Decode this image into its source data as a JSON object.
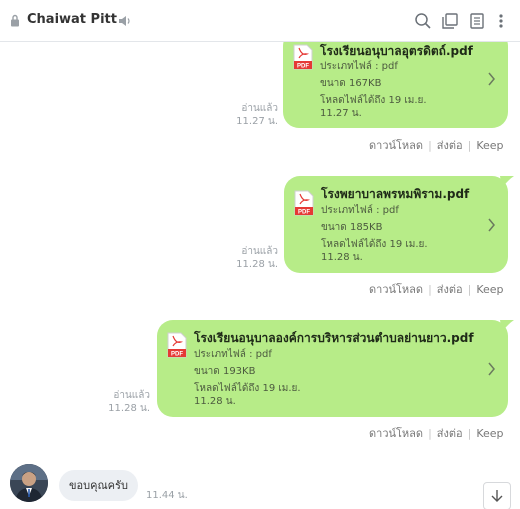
{
  "header": {
    "title": "Chaiwat Pitt"
  },
  "messages": [
    {
      "file_name": "โรงเรียนอนุบาลอุตรดิตถ์.pdf",
      "type_label": "ประเภทไฟล์ : pdf",
      "size_label": "ขนาด 167KB",
      "download_until_line1": "โหลดไฟล์ได้ถึง 19 เม.ย.",
      "download_until_line2": "11.27 น.",
      "read_label": "อ่านแล้ว",
      "time": "11.27 น."
    },
    {
      "file_name": "โรงพยาบาลพรหมพิราม.pdf",
      "type_label": "ประเภทไฟล์ : pdf",
      "size_label": "ขนาด 185KB",
      "download_until_line1": "โหลดไฟล์ได้ถึง 19 เม.ย.",
      "download_until_line2": "11.28 น.",
      "read_label": "อ่านแล้ว",
      "time": "11.28 น."
    },
    {
      "file_name": "โรงเรียนอนุบาลองค์การบริหารส่วนตำบลย่านยาว.pdf",
      "type_label": "ประเภทไฟล์ : pdf",
      "size_label": "ขนาด 193KB",
      "download_until_line1": "โหลดไฟล์ได้ถึง 19 เม.ย.",
      "download_until_line2": "11.28 น.",
      "read_label": "อ่านแล้ว",
      "time": "11.28 น."
    }
  ],
  "actions": {
    "download": "ดาวน์โหลด",
    "forward": "ส่งต่อ",
    "keep": "Keep"
  },
  "reply": {
    "text": "ขอบคุณครับ",
    "time": "11.44 น."
  },
  "colors": {
    "bubble_green": "#b7ec88",
    "received_bubble": "#eceff3",
    "pdf_red": "#e53935"
  },
  "icons": [
    "lock-icon",
    "speaker-icon",
    "search-icon",
    "copy-icon",
    "notes-icon",
    "menu-icon",
    "pdf-icon",
    "chevron-right-icon",
    "arrow-down-icon"
  ]
}
